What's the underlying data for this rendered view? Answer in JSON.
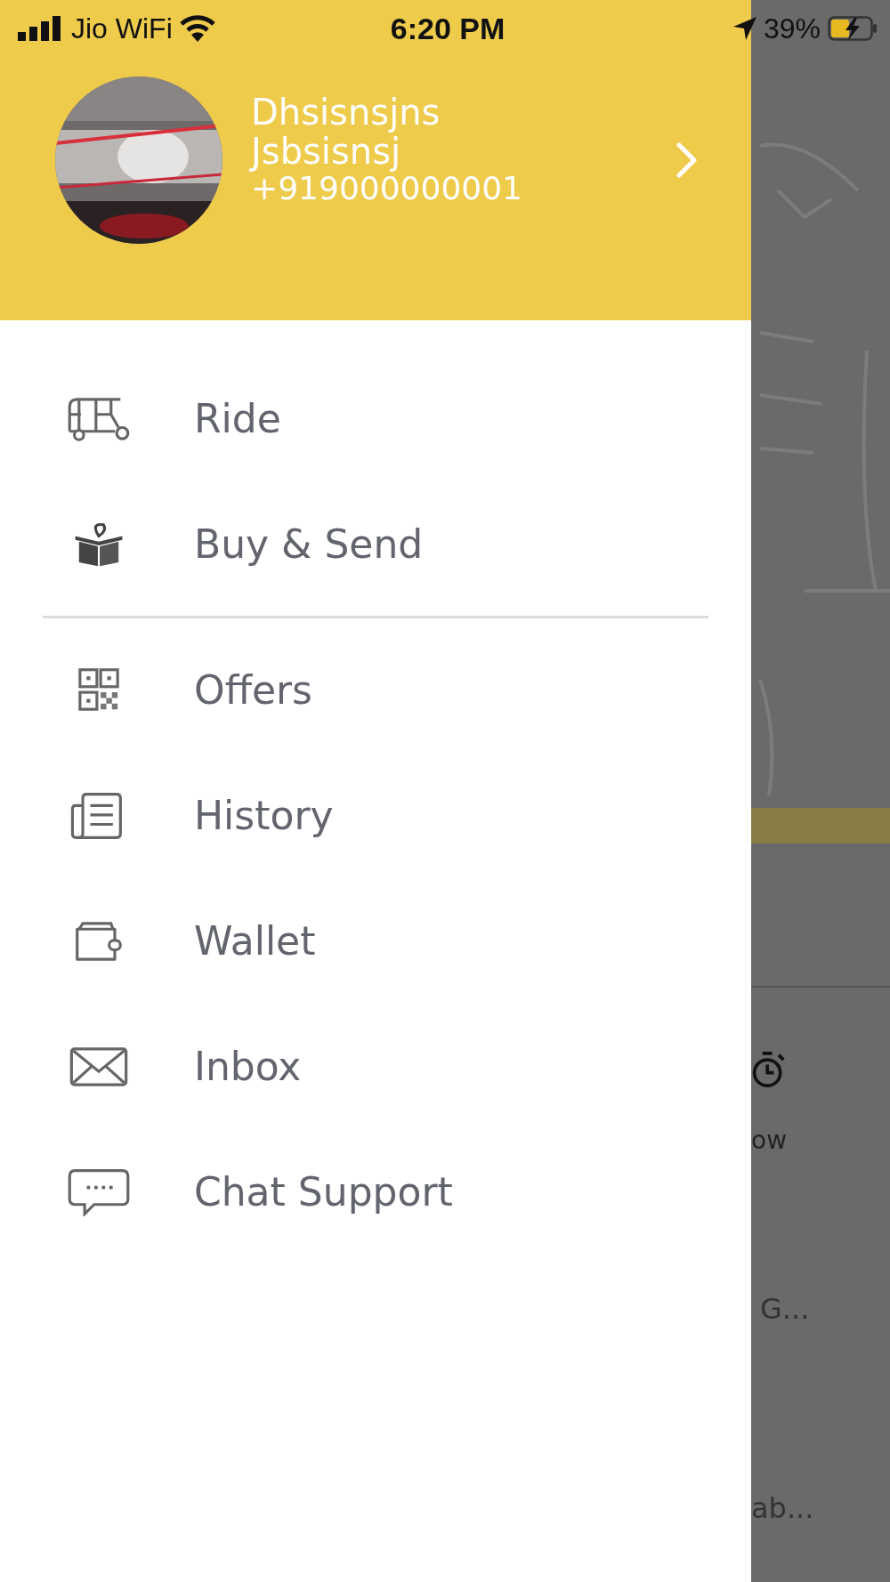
{
  "status_bar": {
    "carrier": "Jio WiFi",
    "time": "6:20 PM",
    "battery": "39%",
    "charging": true
  },
  "profile": {
    "name": "Dhsisnsjns Jsbsisnsj",
    "phone": "+919000000001"
  },
  "menu_sections": [
    {
      "items": [
        {
          "kind": "ride",
          "label": "Ride"
        },
        {
          "kind": "gift",
          "label": "Buy & Send"
        }
      ]
    },
    {
      "items": [
        {
          "kind": "qr",
          "label": "Offers"
        },
        {
          "kind": "history",
          "label": "History"
        },
        {
          "kind": "wallet",
          "label": "Wallet"
        },
        {
          "kind": "inbox",
          "label": "Inbox"
        },
        {
          "kind": "chat",
          "label": "Chat Support"
        }
      ]
    }
  ],
  "background": {
    "texts": [
      "ow",
      "G...",
      "ab..."
    ]
  }
}
